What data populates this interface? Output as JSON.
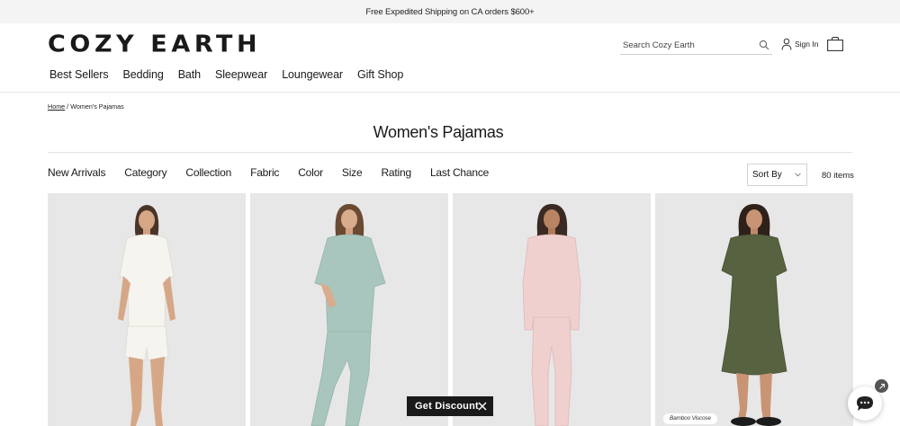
{
  "promo": {
    "text": "Free Expedited Shipping on CA orders $600+"
  },
  "brand": {
    "logo": "COZY EARTH"
  },
  "header": {
    "search_placeholder": "Search Cozy Earth",
    "sign_in": "Sign In"
  },
  "nav": {
    "items": [
      "Best Sellers",
      "Bedding",
      "Bath",
      "Sleepwear",
      "Loungewear",
      "Gift Shop"
    ]
  },
  "breadcrumb": {
    "home": "Home",
    "separator": " / ",
    "current": "Women's Pajamas"
  },
  "page": {
    "title": "Women's Pajamas"
  },
  "filters": {
    "items": [
      "New Arrivals",
      "Category",
      "Collection",
      "Fabric",
      "Color",
      "Size",
      "Rating",
      "Last Chance"
    ]
  },
  "sort": {
    "label": "Sort By"
  },
  "results": {
    "count": "80 items"
  },
  "products": [
    {
      "color": "#f6f4ef",
      "badge": ""
    },
    {
      "color": "#a8c6be",
      "badge": ""
    },
    {
      "color": "#efd0cf",
      "badge": ""
    },
    {
      "color": "#566240",
      "badge": "Bamboo Viscose"
    }
  ],
  "discount": {
    "label": "Get Discount"
  }
}
